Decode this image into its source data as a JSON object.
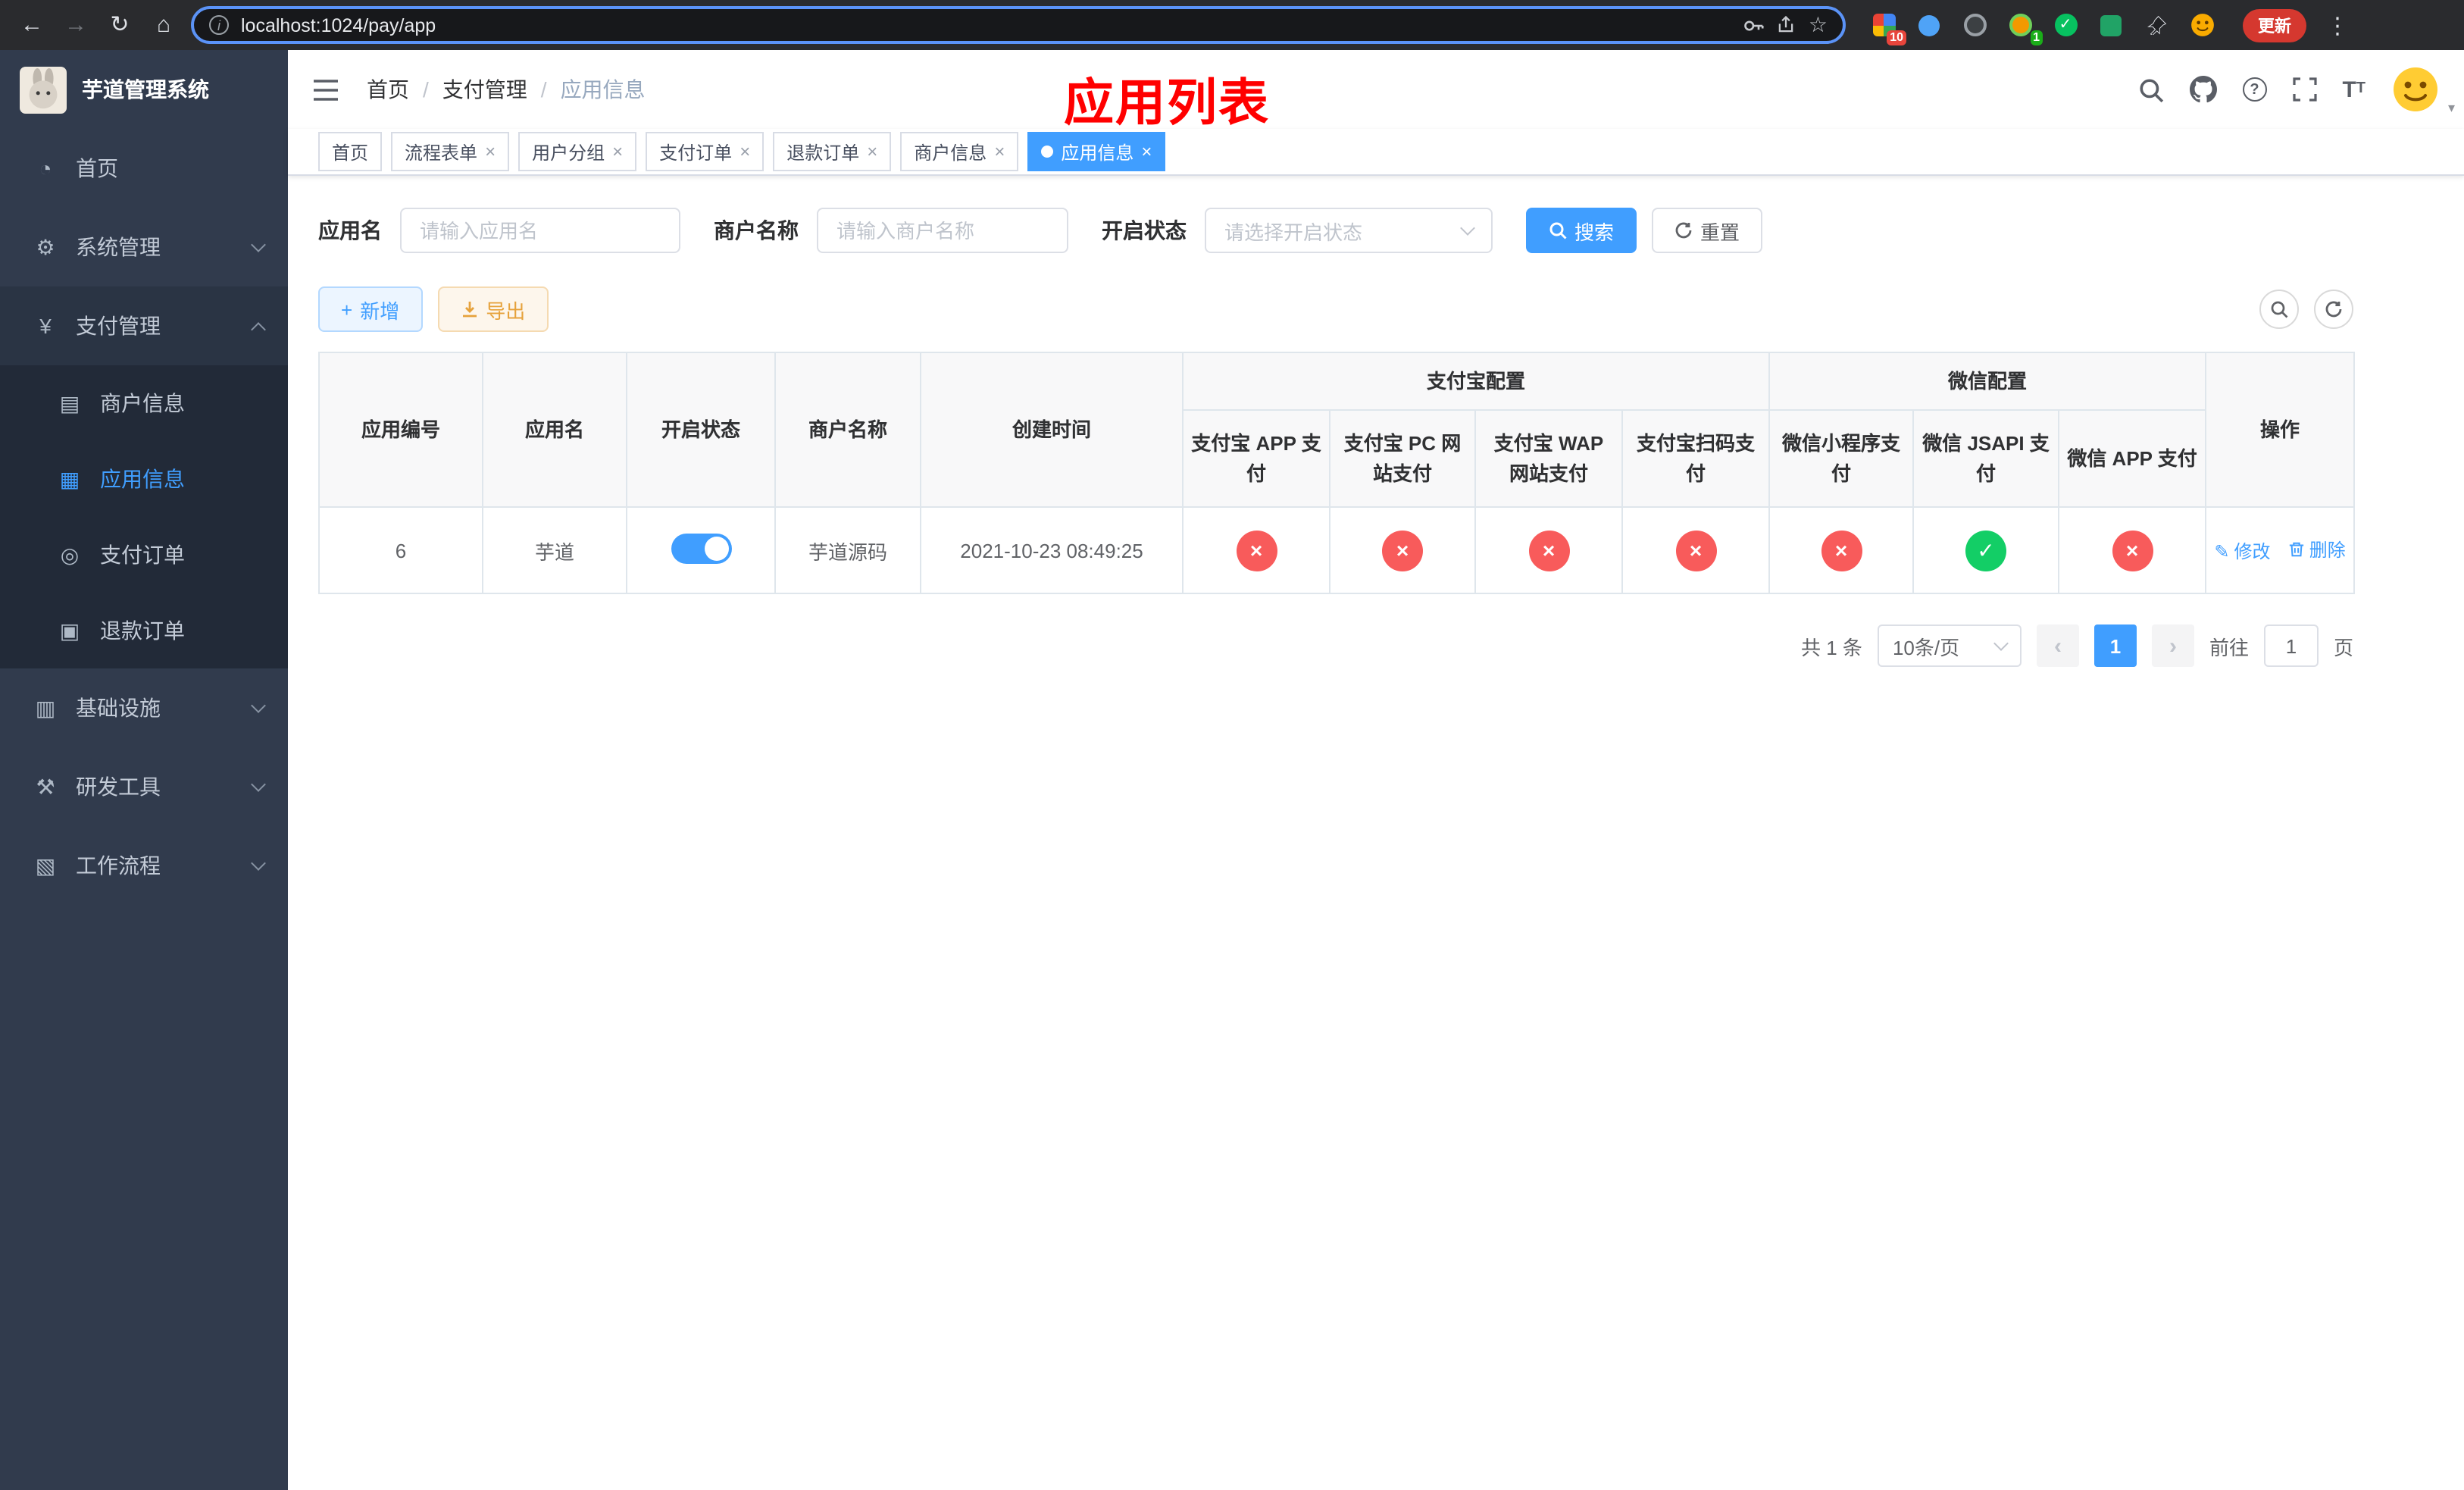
{
  "browser": {
    "url": "localhost:1024/pay/app",
    "update_label": "更新",
    "ext_badge": "10",
    "msg_badge": "1"
  },
  "icons": {
    "back": "←",
    "forward": "→",
    "reload": "↻",
    "home": "⌂",
    "info": "i",
    "star": "☆",
    "dots": "⋮",
    "question": "?",
    "close": "×",
    "check": "✓",
    "edit": "✎",
    "plus": "+",
    "sep": "/",
    "prev": "‹",
    "next": "›",
    "fontsize_big": "T",
    "fontsize_small": "T",
    "caret_down": "▾"
  },
  "sidebar": {
    "logo_title": "芋道管理系统",
    "items": [
      {
        "icon": "◔",
        "label": "首页"
      },
      {
        "icon": "⚙",
        "label": "系统管理"
      },
      {
        "icon": "¥",
        "label": "支付管理"
      },
      {
        "icon": "▤",
        "label": "商户信息"
      },
      {
        "icon": "▦",
        "label": "应用信息"
      },
      {
        "icon": "◎",
        "label": "支付订单"
      },
      {
        "icon": "▣",
        "label": "退款订单"
      },
      {
        "icon": "▥",
        "label": "基础设施"
      },
      {
        "icon": "⚒",
        "label": "研发工具"
      },
      {
        "icon": "▧",
        "label": "工作流程"
      }
    ]
  },
  "header": {
    "crumbs": [
      "首页",
      "支付管理",
      "应用信息"
    ],
    "title": "应用列表"
  },
  "tabs": [
    {
      "label": "首页"
    },
    {
      "label": "流程表单"
    },
    {
      "label": "用户分组"
    },
    {
      "label": "支付订单"
    },
    {
      "label": "退款订单"
    },
    {
      "label": "商户信息"
    },
    {
      "label": "应用信息"
    }
  ],
  "filters": {
    "app_name_label": "应用名",
    "app_name_placeholder": "请输入应用名",
    "merchant_label": "商户名称",
    "merchant_placeholder": "请输入商户名称",
    "status_label": "开启状态",
    "status_placeholder": "请选择开启状态",
    "search": "搜索",
    "reset": "重置"
  },
  "toolbar": {
    "add": "新增",
    "export": "导出"
  },
  "table": {
    "group_alipay": "支付宝配置",
    "group_wechat": "微信配置",
    "col_id": "应用编号",
    "col_name": "应用名",
    "col_status": "开启状态",
    "col_merchant": "商户名称",
    "col_created": "创建时间",
    "col_actions": "操作",
    "sub": [
      "支付宝 APP 支付",
      "支付宝 PC 网站支付",
      "支付宝 WAP 网站支付",
      "支付宝扫码支付",
      "微信小程序支付",
      "微信 JSAPI 支付",
      "微信 APP 支付"
    ],
    "row": {
      "id": "6",
      "name": "芋道",
      "merchant": "芋道源码",
      "created": "2021-10-23 08:49:25",
      "edit": "修改",
      "delete": "删除"
    }
  },
  "pagination": {
    "total": "共 1 条",
    "size": "10条/页",
    "page": "1",
    "goto": "前往",
    "goto_value": "1",
    "unit": "页"
  },
  "colors": {
    "accent": "#409eff",
    "danger": "#f85b5b",
    "success": "#13ce66",
    "title_red": "#ff0000"
  }
}
